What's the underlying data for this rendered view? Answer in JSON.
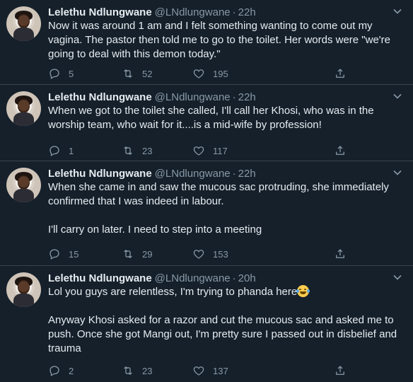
{
  "tweets": [
    {
      "name": "Lelethu Ndlungwane",
      "handle": "@LNdlungwane",
      "time": "22h",
      "paragraphs": [
        "Now it was around 1 am and I felt something wanting to come out my vagina. The pastor then told me to go to the toilet. Her words were \"we're going to deal with this demon today.\""
      ],
      "replies": "5",
      "retweets": "52",
      "likes": "195"
    },
    {
      "name": "Lelethu Ndlungwane",
      "handle": "@LNdlungwane",
      "time": "22h",
      "paragraphs": [
        "When we got to the toilet she called, I'll call her Khosi, who was in the worship team, who wait for it....is a mid-wife by profession!"
      ],
      "replies": "1",
      "retweets": "23",
      "likes": "117"
    },
    {
      "name": "Lelethu Ndlungwane",
      "handle": "@LNdlungwane",
      "time": "22h",
      "paragraphs": [
        "When she came in and saw the mucous sac protruding, she immediately confirmed that I was indeed in labour.",
        "I'll carry on later. I need to step into a meeting"
      ],
      "replies": "15",
      "retweets": "29",
      "likes": "153"
    },
    {
      "name": "Lelethu Ndlungwane",
      "handle": "@LNdlungwane",
      "time": "20h",
      "paragraphs": [
        "Lol you guys are relentless, I'm trying to phanda here",
        "Anyway Khosi asked for a razor and cut the mucous sac and asked me to push. Once she got Mangi out, I'm pretty sure I passed out in disbelief and trauma"
      ],
      "replies": "2",
      "retweets": "23",
      "likes": "137"
    }
  ],
  "icons": {
    "reply": "reply-icon",
    "retweet": "retweet-icon",
    "like": "heart-icon",
    "share": "share-icon",
    "menu": "chevron-down-icon",
    "emoji": "face-with-tears-of-joy-emoji"
  },
  "colors": {
    "background": "#15202b",
    "text": "#e6ecf0",
    "secondary": "#8899a6",
    "divider": "#38444d"
  }
}
